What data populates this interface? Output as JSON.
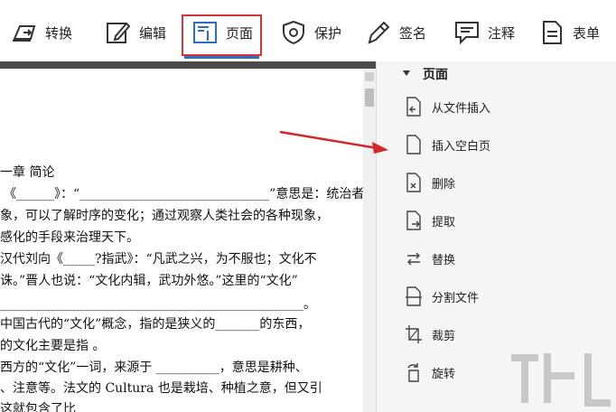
{
  "toolbar": {
    "items": [
      {
        "label": "转换",
        "icon": "convert-icon"
      },
      {
        "label": "编辑",
        "icon": "edit-icon"
      },
      {
        "label": "页面",
        "icon": "page-icon",
        "selected": true
      },
      {
        "label": "保护",
        "icon": "shield-icon"
      },
      {
        "label": "签名",
        "icon": "pen-icon"
      },
      {
        "label": "注释",
        "icon": "comment-icon"
      },
      {
        "label": "表单",
        "icon": "form-icon"
      }
    ]
  },
  "document": {
    "lines": [
      "一章  简论",
      "《______》：“______________________________”意思是：统治者",
      "象，可以了解时序的变化；通过观察人类社会的各种现象，",
      "感化的手段来治理天下。",
      " 汉代刘向《_____?指武》：“凡武之兴，为不服也；文化不",
      "诛。”晋人也说：“文化内辑，武功外悠。”这里的“文化”",
      "________________________________________________。",
      " 中国古代的“文化”概念，指的是狭义的_______的东西，",
      "的文化主要是指                                  。",
      " 西方的“文化”一词，来源于 __________，意思是耕种、",
      "、注意等。法文的 Cultura 也是栽培、种植之意，但又引",
      "                    这就包含了比_______"
    ]
  },
  "panel": {
    "title": "页面",
    "items": [
      {
        "label": "从文件插入",
        "icon": "insert-from-file-icon"
      },
      {
        "label": "插入空白页",
        "icon": "insert-blank-page-icon"
      },
      {
        "label": "删除",
        "icon": "delete-page-icon"
      },
      {
        "label": "提取",
        "icon": "extract-page-icon"
      },
      {
        "label": "替换",
        "icon": "replace-page-icon"
      },
      {
        "label": "分割文件",
        "icon": "split-file-icon"
      },
      {
        "label": "裁剪",
        "icon": "crop-icon"
      },
      {
        "label": "旋转",
        "icon": "rotate-icon"
      }
    ]
  },
  "colors": {
    "highlight_box": "#d4353a",
    "selected_underline": "#2b6cc4",
    "arrow": "#d4262b"
  }
}
